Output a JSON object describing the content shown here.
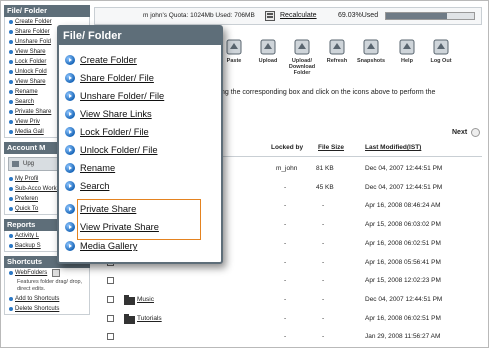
{
  "sidebar": {
    "title1": "File/ Folder",
    "items1": [
      "Create Folder",
      "Share Folder",
      "Unshare Fold",
      "View Share",
      "Lock Folder",
      "Unlock Fold",
      "View Share",
      "Rename",
      "Search",
      "Private Share",
      "View Priv",
      "Media Gall"
    ],
    "title2": "Account M",
    "upgrade": "Upg",
    "items2": [
      "My Profil",
      "Sub-Acco WorkGro",
      "Preferen",
      "Quick To"
    ],
    "title3": "Reports",
    "items3": [
      "Activity L",
      "Backup S"
    ],
    "title4": "Shortcuts",
    "webfolders": "WebFolders",
    "webfolders_desc": "Features folder drag/ drop, direct edits.",
    "add_shortcuts": "Add to Shortcuts",
    "delete_shortcuts": "Delete Shortcuts"
  },
  "topbar": {
    "quota": "m john's Quota: 1024Mb Used: 706MB",
    "recalculate": "Recalculate",
    "percent": "69.03%Used",
    "used_fraction": 0.6903
  },
  "toolbar": [
    {
      "label": "Paste",
      "icon": "paste-icon"
    },
    {
      "label": "Upload",
      "icon": "upload-icon"
    },
    {
      "label": "Upload/ Download Folder",
      "icon": "upload-download-folder-icon"
    },
    {
      "label": "Refresh",
      "icon": "refresh-icon"
    },
    {
      "label": "Snapshots",
      "icon": "snapshots-icon"
    },
    {
      "label": "Help",
      "icon": "help-icon"
    },
    {
      "label": "Log Out",
      "icon": "logout-icon"
    }
  ],
  "instruction": "ng the corresponding box and click on the icons above to perform the",
  "instruction_tail": "",
  "next": "Next",
  "table": {
    "headers": {
      "locked_by": "Locked by",
      "file_size": "File Size",
      "last_modified": "Last Modified(IST)"
    },
    "rows": [
      {
        "name": "",
        "locked_by": "m_john",
        "size": "81 KB",
        "date": "Dec 04, 2007 12:44:51 PM"
      },
      {
        "name": "",
        "locked_by": "-",
        "size": "45 KB",
        "date": "Dec 04, 2007 12:44:51 PM"
      },
      {
        "name": "",
        "locked_by": "-",
        "size": "-",
        "date": "Apr 16, 2008 08:46:24 AM"
      },
      {
        "name": "",
        "locked_by": "-",
        "size": "-",
        "date": "Apr 15, 2008 06:03:02 PM"
      },
      {
        "name": "",
        "locked_by": "-",
        "size": "-",
        "date": "Apr 16, 2008 06:02:51 PM"
      },
      {
        "name": "",
        "locked_by": "-",
        "size": "-",
        "date": "Apr 16, 2008 05:56:41 PM"
      },
      {
        "name": "",
        "locked_by": "-",
        "size": "-",
        "date": "Apr 15, 2008 12:02:23 PM"
      },
      {
        "name": "Music",
        "locked_by": "-",
        "size": "-",
        "date": "Dec 04, 2007 12:44:51 PM"
      },
      {
        "name": "Tutorials",
        "locked_by": "-",
        "size": "-",
        "date": "Apr 16, 2008 06:02:51 PM"
      },
      {
        "name": "",
        "locked_by": "-",
        "size": "-",
        "date": "Jan 29, 2008 11:56:27 AM"
      }
    ]
  },
  "popup": {
    "title": "File/ Folder",
    "items": [
      "Create Folder",
      "Share Folder/ File",
      "Unshare Folder/ File",
      "View Share Links",
      "Lock Folder/ File",
      "Unlock Folder/ File",
      "Rename",
      "Search",
      "Private Share",
      "View Private Share",
      "Media Gallery"
    ],
    "highlight_color": "#e48320"
  }
}
